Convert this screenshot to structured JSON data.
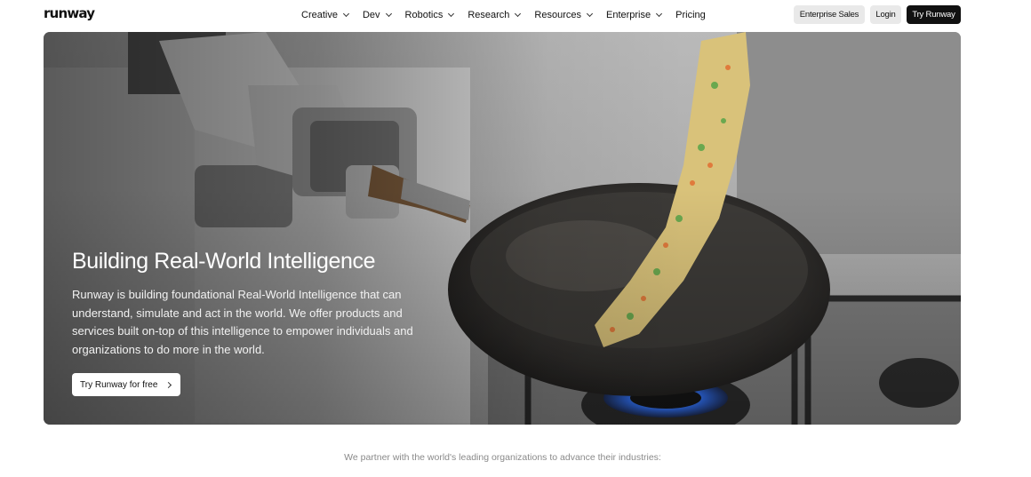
{
  "header": {
    "logo": "runway",
    "nav": [
      {
        "label": "Creative",
        "dropdown": true
      },
      {
        "label": "Dev",
        "dropdown": true
      },
      {
        "label": "Robotics",
        "dropdown": true
      },
      {
        "label": "Research",
        "dropdown": true
      },
      {
        "label": "Resources",
        "dropdown": true
      },
      {
        "label": "Enterprise",
        "dropdown": true
      },
      {
        "label": "Pricing",
        "dropdown": false
      }
    ],
    "enterprise_sales": "Enterprise Sales",
    "login": "Login",
    "try_runway": "Try Runway"
  },
  "hero": {
    "title": "Building Real-World Intelligence",
    "description": "Runway is building foundational Real-World Intelligence that can understand, simulate and act in the world. We offer products and services built on-top of this intelligence to empower individuals and organizations to do more in the world.",
    "cta_label": "Try Runway for free",
    "image_icon": "robot-cooking-wok-image"
  },
  "partner_text": "We partner with the world's leading organizations to advance their industries:",
  "colors": {
    "primary_button": "#111111",
    "secondary_button": "#e9e9e9",
    "burner_flame": "#2d6cf0"
  }
}
